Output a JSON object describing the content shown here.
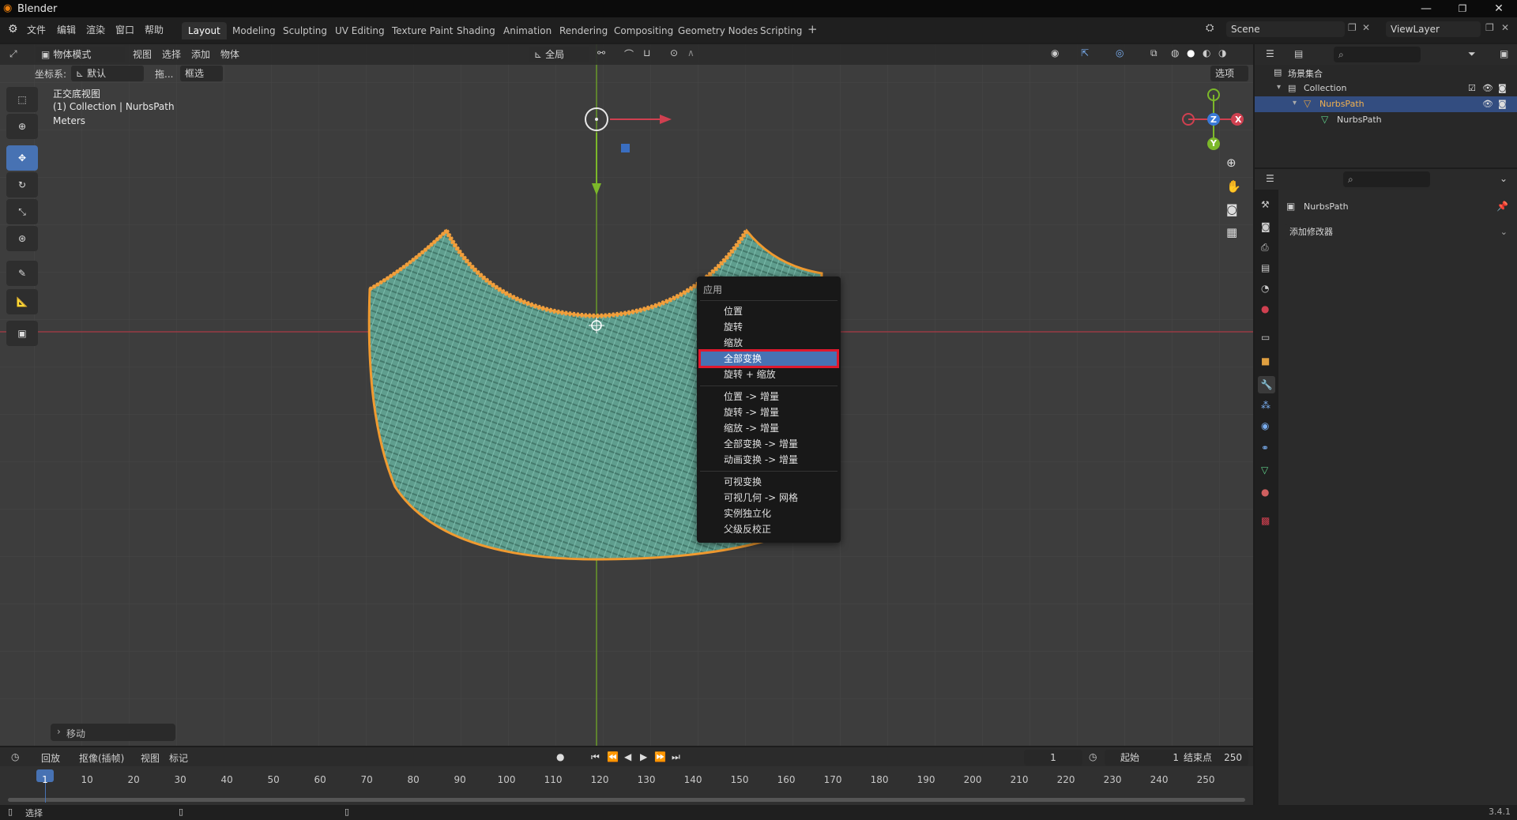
{
  "window": {
    "title": "Blender"
  },
  "menu": [
    "文件",
    "编辑",
    "渲染",
    "窗口",
    "帮助"
  ],
  "workspaces": [
    "Layout",
    "Modeling",
    "Sculpting",
    "UV Editing",
    "Texture Paint",
    "Shading",
    "Animation",
    "Rendering",
    "Compositing",
    "Geometry Nodes",
    "Scripting"
  ],
  "scene": {
    "name": "Scene",
    "view_layer": "ViewLayer"
  },
  "viewport_header": {
    "mode": "物体模式",
    "menus": [
      "视图",
      "选择",
      "添加",
      "物体"
    ],
    "transform_orientation": "全局"
  },
  "viewport_sub": {
    "coord_label": "坐标系:",
    "coord_value": "默认",
    "drag_label": "拖...",
    "drag_value": "框选",
    "options": "选项"
  },
  "overlay": {
    "view_name": "正交底视图",
    "collection": "(1) Collection | NurbsPath",
    "units": "Meters"
  },
  "gizmo": {
    "x": "X",
    "y": "Y",
    "z": "Z"
  },
  "last_operator": "移动",
  "context_menu": {
    "title": "应用",
    "group1": [
      "位置",
      "旋转",
      "缩放",
      "全部变换",
      "旋转 + 缩放"
    ],
    "highlighted": "全部变换",
    "group2": [
      "位置 -> 增量",
      "旋转 -> 增量",
      "缩放 -> 增量",
      "全部变换 -> 增量",
      "动画变换 -> 增量"
    ],
    "group3": [
      "可视变换",
      "可视几何 -> 网格",
      "实例独立化",
      "父级反校正"
    ]
  },
  "outliner": {
    "root": "场景集合",
    "collection": "Collection",
    "object": "NurbsPath",
    "data": "NurbsPath"
  },
  "properties": {
    "object": "NurbsPath",
    "add_modifier": "添加修改器"
  },
  "timeline": {
    "menus": [
      "回放",
      "抠像(插帧)",
      "视图",
      "标记"
    ],
    "current_frame": "1",
    "start_label": "起始",
    "start": "1",
    "end_label": "结束点",
    "end": "250",
    "ticks": [
      "1",
      "10",
      "20",
      "30",
      "40",
      "50",
      "60",
      "70",
      "80",
      "90",
      "100",
      "110",
      "120",
      "130",
      "140",
      "150",
      "160",
      "170",
      "180",
      "190",
      "200",
      "210",
      "220",
      "230",
      "240",
      "250"
    ]
  },
  "status": {
    "select": "选择",
    "version": "3.4.1"
  }
}
